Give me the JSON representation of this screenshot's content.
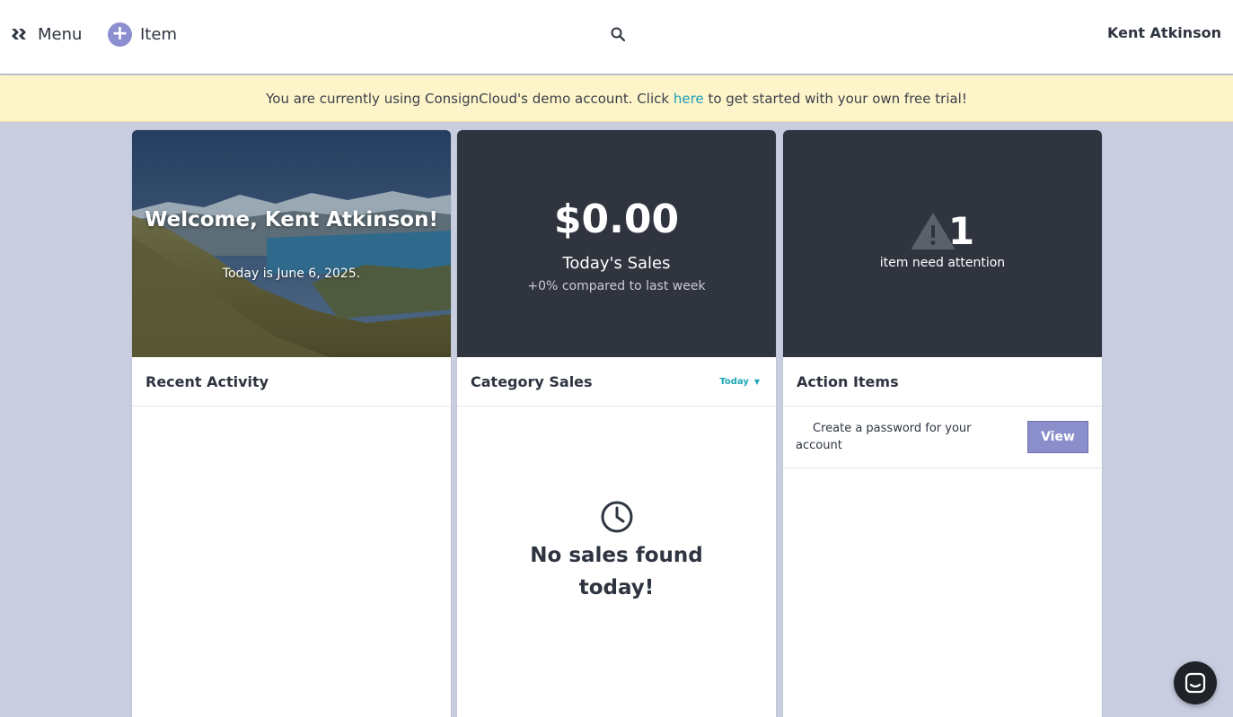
{
  "topbar": {
    "menu_label": "Menu",
    "item_label": "Item",
    "user_name": "Kent Atkinson"
  },
  "icons": {
    "menu": "menu-icon",
    "add": "plus-circle-icon",
    "search": "search-icon",
    "warning": "warning-triangle-icon",
    "clock": "clock-icon",
    "chat": "chat-icon"
  },
  "banner": {
    "text_before": "You are currently using ConsignCloud's demo account. Click",
    "link_text": "here",
    "text_after": "to get started with your own free trial!"
  },
  "welcome": {
    "title": "Welcome, Kent Atkinson!",
    "date_text": "Today is June 6, 2025."
  },
  "sales": {
    "amount": "$0.00",
    "label": "Today's Sales",
    "compare": "+0% compared to last week"
  },
  "attention": {
    "count": "1",
    "label": "item need attention"
  },
  "recent_activity": {
    "title": "Recent Activity"
  },
  "category_sales": {
    "title": "Category Sales",
    "period": "Today",
    "empty_text": "No sales found today!"
  },
  "action_items": {
    "title": "Action Items",
    "items": [
      {
        "text": "Create a password for your account",
        "button_label": "View"
      }
    ]
  },
  "colors": {
    "accent": "#8b8fcf",
    "link": "#1d9bb5",
    "banner_bg": "#fdf5c9",
    "dark_card": "#2f343f",
    "page_bg": "#c9cde0"
  }
}
